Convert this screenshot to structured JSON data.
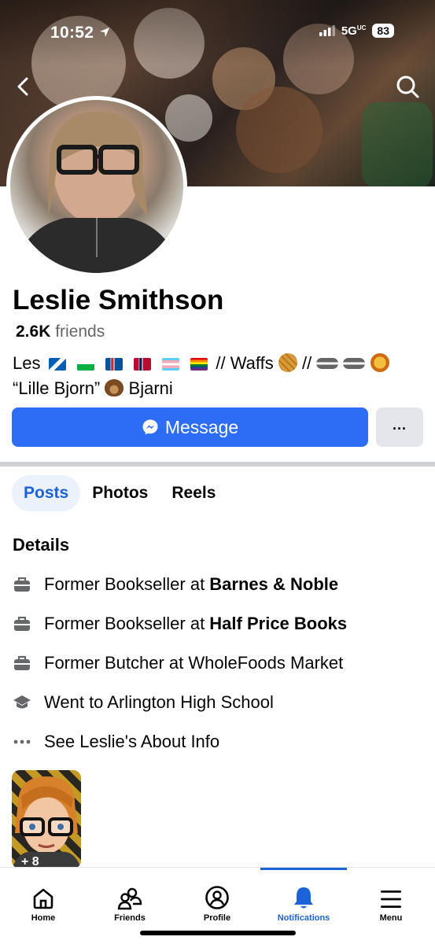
{
  "status": {
    "time": "10:52",
    "network": "5G",
    "network_sup": "UC",
    "battery": "83"
  },
  "profile": {
    "name": "Leslie Smithson",
    "friends_count": "2.6K",
    "friends_label": "friends",
    "bio_line1_prefix": "Les",
    "bio_line1_mid": "// Waffs",
    "bio_line1_sep": "//",
    "bio_line2_quote": "“Lille Bjorn”",
    "bio_line2_name": "Bjarni"
  },
  "actions": {
    "message_label": "Message",
    "more_label": "..."
  },
  "tabs": [
    {
      "label": "Posts"
    },
    {
      "label": "Photos"
    },
    {
      "label": "Reels"
    }
  ],
  "details": {
    "heading": "Details",
    "items": [
      {
        "icon": "briefcase-icon",
        "prefix": "Former Bookseller at ",
        "bold": "Barnes & Noble"
      },
      {
        "icon": "briefcase-icon",
        "prefix": "Former Bookseller at ",
        "bold": "Half Price Books"
      },
      {
        "icon": "briefcase-icon",
        "prefix": "Former Butcher at WholeFoods Market",
        "bold": ""
      },
      {
        "icon": "graduation-cap-icon",
        "prefix": "Went to Arlington High School",
        "bold": ""
      },
      {
        "icon": "more-dots-icon",
        "prefix": "See Leslie's About Info",
        "bold": ""
      }
    ]
  },
  "thumb_badge": "+ 8",
  "nav": [
    {
      "label": "Home",
      "icon": "home-icon"
    },
    {
      "label": "Friends",
      "icon": "friends-icon"
    },
    {
      "label": "Profile",
      "icon": "profile-icon"
    },
    {
      "label": "Notifications",
      "icon": "bell-icon"
    },
    {
      "label": "Menu",
      "icon": "menu-icon"
    }
  ],
  "colors": {
    "accent": "#2d6df5",
    "active_tab_bg": "#ebf2fc",
    "active_text": "#1c63d8"
  }
}
